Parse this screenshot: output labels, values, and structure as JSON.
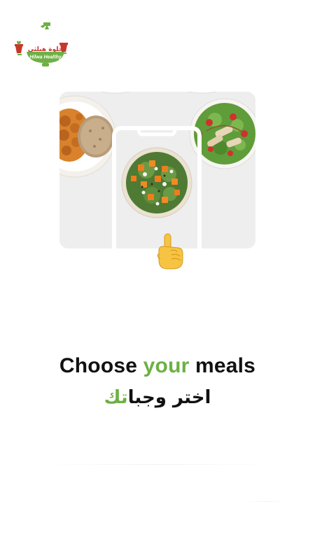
{
  "logo": {
    "arabic_text": "حلوة هيلثي",
    "english_text": "Hilwa Healthy"
  },
  "illustration": {
    "items": [
      "curry-rice-bowl",
      "pumpkin-salad-bowl",
      "strawberry-chicken-salad",
      "phone-outline",
      "pointing-hand-icon"
    ]
  },
  "headline": {
    "part1": "Choose ",
    "accent": "your",
    "part2": " meals"
  },
  "subheadline": {
    "part1": "اختر وجبا",
    "accent": "تك"
  },
  "colors": {
    "accent": "#6db043",
    "brand_red": "#c8372c",
    "text": "#111111",
    "card_bg": "#eeeeee"
  }
}
